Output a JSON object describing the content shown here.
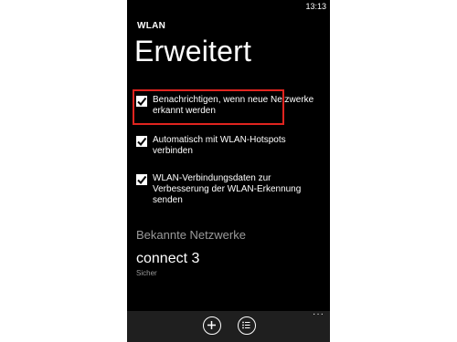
{
  "status_bar": {
    "time": "13:13"
  },
  "header": {
    "app_title": "WLAN",
    "page_title": "Erweitert"
  },
  "options": [
    {
      "label": "Benachrichtigen, wenn neue Netzwerke erkannt werden",
      "checked": true,
      "highlighted": true
    },
    {
      "label": "Automatisch mit WLAN-Hotspots verbinden",
      "checked": true
    },
    {
      "label": "WLAN-Verbindungsdaten zur Verbesserung der WLAN-Erkennung senden",
      "checked": true
    }
  ],
  "known_networks": {
    "header": "Bekannte Netzwerke",
    "items": [
      {
        "name": "connect 3",
        "status": "Sicher"
      }
    ]
  },
  "app_bar": {
    "buttons": [
      {
        "icon": "add-icon"
      },
      {
        "icon": "list-icon"
      }
    ],
    "more": "···"
  },
  "colors": {
    "highlight": "#e0241f",
    "background": "#000000",
    "appbar": "#1f1f1f"
  }
}
